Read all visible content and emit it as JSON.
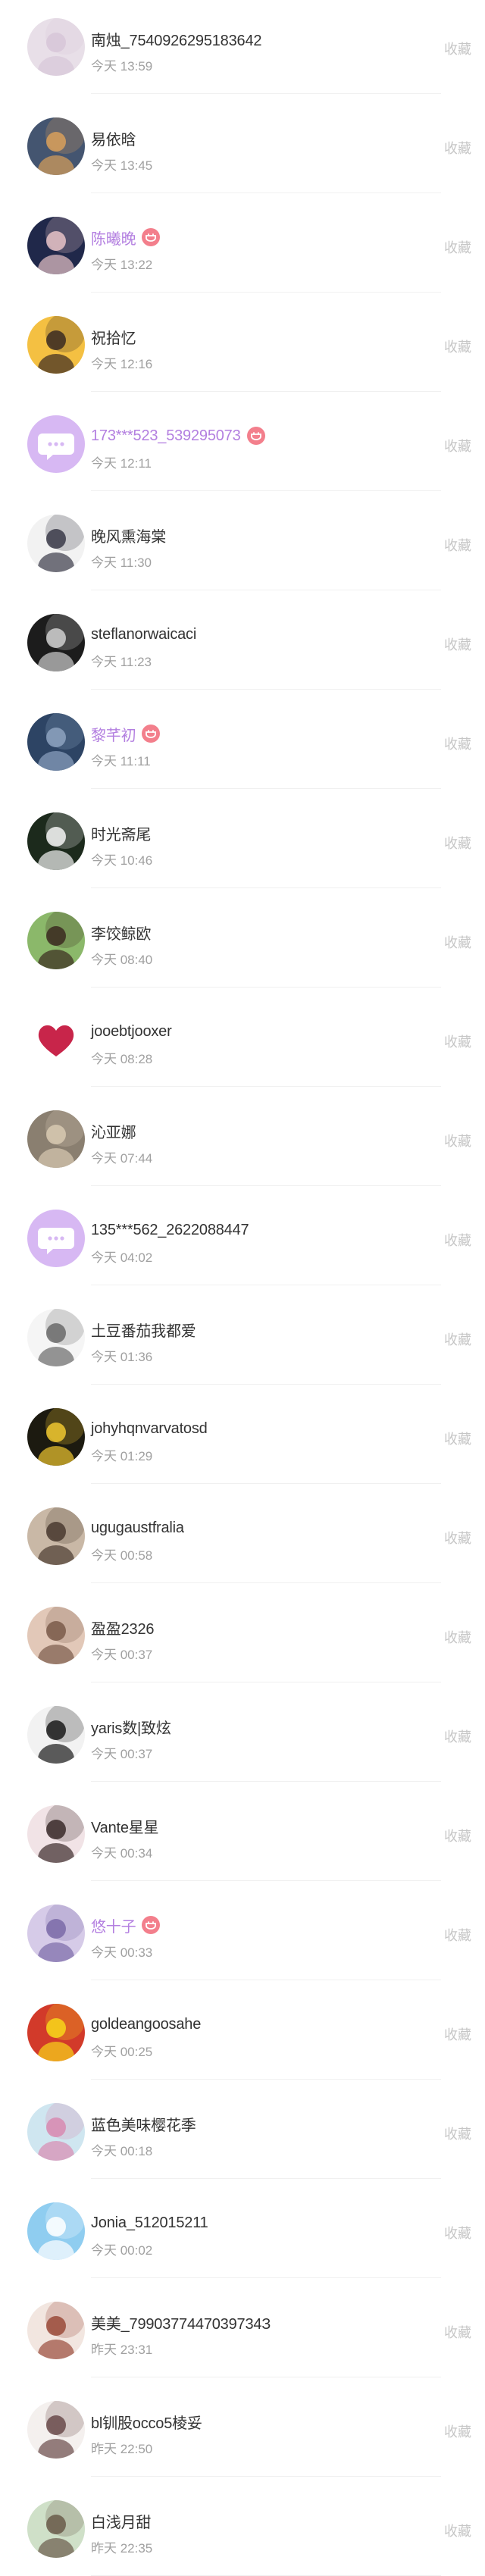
{
  "collect_label": "收藏",
  "colors": {
    "vip_name": "#b37fe0",
    "vip_badge": "#f37f8c",
    "collect_text": "#c6c6c6",
    "time_text": "#a0a0a0"
  },
  "items": [
    {
      "name": "南烛_7540926295183642",
      "time": "今天 13:59",
      "vip": false,
      "avatar": {
        "kind": "photo",
        "bg": "#e8dfe8",
        "fg": "#d7c6d8"
      }
    },
    {
      "name": "易依晗",
      "time": "今天 13:45",
      "vip": false,
      "avatar": {
        "kind": "photo",
        "bg": "#445570",
        "fg": "#d9a05a"
      }
    },
    {
      "name": "陈曦晚",
      "time": "今天 13:22",
      "vip": true,
      "avatar": {
        "kind": "photo",
        "bg": "#20284a",
        "fg": "#e8c3c8"
      }
    },
    {
      "name": "祝拾忆",
      "time": "今天 12:16",
      "vip": false,
      "avatar": {
        "kind": "photo",
        "bg": "#f4c042",
        "fg": "#3a2a22"
      }
    },
    {
      "name": "173***523_539295073",
      "time": "今天 12:11",
      "vip": true,
      "avatar": {
        "kind": "default",
        "bg": "#d7b8f3",
        "fg": "#ffffff"
      }
    },
    {
      "name": "晚风熏海棠",
      "time": "今天 11:30",
      "vip": false,
      "avatar": {
        "kind": "photo",
        "bg": "#f2f2f2",
        "fg": "#3a3a48"
      }
    },
    {
      "name": "steflanorwaicaci",
      "time": "今天 11:23",
      "vip": false,
      "avatar": {
        "kind": "photo",
        "bg": "#1c1c1c",
        "fg": "#cfcfcf"
      }
    },
    {
      "name": "黎芊初",
      "time": "今天 11:11",
      "vip": true,
      "avatar": {
        "kind": "photo",
        "bg": "#2d4464",
        "fg": "#8da2c0"
      }
    },
    {
      "name": "时光斋尾",
      "time": "今天 10:46",
      "vip": false,
      "avatar": {
        "kind": "photo",
        "bg": "#1c2a1c",
        "fg": "#f5f5f5"
      }
    },
    {
      "name": "李饺鲸欧",
      "time": "今天 08:40",
      "vip": false,
      "avatar": {
        "kind": "photo",
        "bg": "#8bb86a",
        "fg": "#3b2a20"
      }
    },
    {
      "name": "jooebtjooxer",
      "time": "今天 08:28",
      "vip": false,
      "avatar": {
        "kind": "heart",
        "bg": "#ffffff",
        "fg": "#c8254a"
      }
    },
    {
      "name": "沁亚娜",
      "time": "今天 07:44",
      "vip": false,
      "avatar": {
        "kind": "photo",
        "bg": "#8a7f70",
        "fg": "#d8c9b2"
      }
    },
    {
      "name": "135***562_2622088447",
      "time": "今天 04:02",
      "vip": false,
      "avatar": {
        "kind": "default",
        "bg": "#d7b8f3",
        "fg": "#ffffff"
      }
    },
    {
      "name": "土豆番茄我都爱",
      "time": "今天 01:36",
      "vip": false,
      "avatar": {
        "kind": "photo",
        "bg": "#f5f5f5",
        "fg": "#6a6a6a"
      }
    },
    {
      "name": "johyhqnvarvatosd",
      "time": "今天 01:29",
      "vip": false,
      "avatar": {
        "kind": "photo",
        "bg": "#1c1a10",
        "fg": "#f0c830"
      }
    },
    {
      "name": "ugugaustfralia",
      "time": "今天 00:58",
      "vip": false,
      "avatar": {
        "kind": "photo",
        "bg": "#c9b8a6",
        "fg": "#4a3a30"
      }
    },
    {
      "name": "盈盈2326",
      "time": "今天 00:37",
      "vip": false,
      "avatar": {
        "kind": "photo",
        "bg": "#e2c8b8",
        "fg": "#7a5a4a"
      }
    },
    {
      "name": "yaris数|致炫",
      "time": "今天 00:37",
      "vip": false,
      "avatar": {
        "kind": "photo",
        "bg": "#f2f2f2",
        "fg": "#1a1a1a"
      }
    },
    {
      "name": "Vante星星",
      "time": "今天 00:34",
      "vip": false,
      "avatar": {
        "kind": "photo",
        "bg": "#f1e3e6",
        "fg": "#3a2a2a"
      }
    },
    {
      "name": "悠十子",
      "time": "今天 00:33",
      "vip": true,
      "avatar": {
        "kind": "photo",
        "bg": "#d6cbe8",
        "fg": "#7a6aa8"
      }
    },
    {
      "name": "goldeangoosahe",
      "time": "今天 00:25",
      "vip": false,
      "avatar": {
        "kind": "photo",
        "bg": "#d23a2a",
        "fg": "#f7d61a"
      }
    },
    {
      "name": "蓝色美味樱花季",
      "time": "今天 00:18",
      "vip": false,
      "avatar": {
        "kind": "photo",
        "bg": "#cfe6f0",
        "fg": "#d88ab0"
      }
    },
    {
      "name": "Jonia_512015211",
      "time": "今天 00:02",
      "vip": false,
      "avatar": {
        "kind": "photo",
        "bg": "#8fcdf0",
        "fg": "#ffffff"
      }
    },
    {
      "name": "美美_7990377447039734З",
      "time": "昨天 23:31",
      "vip": false,
      "avatar": {
        "kind": "photo",
        "bg": "#f2e6e0",
        "fg": "#9a4a3a"
      }
    },
    {
      "name": "bl钏股occo5棱妥",
      "time": "昨天 22:50",
      "vip": false,
      "avatar": {
        "kind": "photo",
        "bg": "#f4f0ee",
        "fg": "#6a4a4a"
      }
    },
    {
      "name": "白浅月甜",
      "time": "昨天 22:35",
      "vip": false,
      "avatar": {
        "kind": "photo",
        "bg": "#cfe0c8",
        "fg": "#6a5a4a"
      }
    }
  ]
}
